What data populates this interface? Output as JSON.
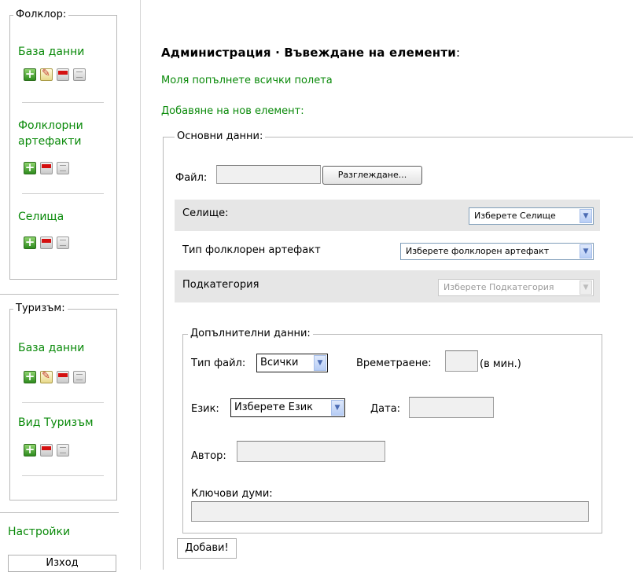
{
  "sidebar": {
    "folklore": {
      "legend": "Фолклор:",
      "sections": [
        {
          "label": "База данни",
          "icons": [
            "add-icon",
            "edit-icon",
            "delete-icon",
            "list-icon"
          ]
        },
        {
          "label": "Фолклорни артефакти",
          "icons": [
            "add-icon",
            "delete-icon",
            "list-icon"
          ]
        },
        {
          "label": "Селища",
          "icons": [
            "add-icon",
            "delete-icon",
            "list-icon"
          ]
        }
      ]
    },
    "tourism": {
      "legend": "Туризъм:",
      "sections": [
        {
          "label": "База данни",
          "icons": [
            "add-icon",
            "edit-icon",
            "delete-icon",
            "list-icon"
          ]
        },
        {
          "label": "Вид Туризъм",
          "icons": [
            "add-icon",
            "delete-icon",
            "list-icon"
          ]
        }
      ]
    },
    "settings_label": "Настройки",
    "logout_label": "Изход"
  },
  "main": {
    "title": "Администрация · Въвеждане на елементи",
    "title_colon": ":",
    "instruction": "Моля попълнете всички полета",
    "add_new": "Добавяне на нов елемент:",
    "basic": {
      "legend": "Основни данни:",
      "file_label": "Файл:",
      "file_value": "",
      "browse_label": "Разглеждане...",
      "rows": [
        {
          "label": "Селище:",
          "select": "Изберете Селище",
          "disabled": false
        },
        {
          "label": "Тип фолклорен артефакт",
          "select": "Изберете фолклорен артефакт",
          "disabled": false
        },
        {
          "label": "Подкатегория",
          "select": "Изберете Подкатегория",
          "disabled": true
        }
      ]
    },
    "extra": {
      "legend": "Допълнителни данни:",
      "filetype_label": "Тип файл:",
      "filetype_value": "Всички",
      "duration_label": "Времетраене:",
      "duration_value": "",
      "duration_unit": "(в мин.)",
      "language_label": "Език:",
      "language_value": "Изберете Език",
      "date_label": "Дата:",
      "date_value": "",
      "author_label": "Автор:",
      "author_value": "",
      "keywords_label": "Ключови думи:",
      "keywords_value": ""
    },
    "submit_label": "Добави!"
  },
  "colors": {
    "link_green": "#0a8a0a",
    "row_gray": "#e6e6e6",
    "select_border": "#7f9db9"
  }
}
